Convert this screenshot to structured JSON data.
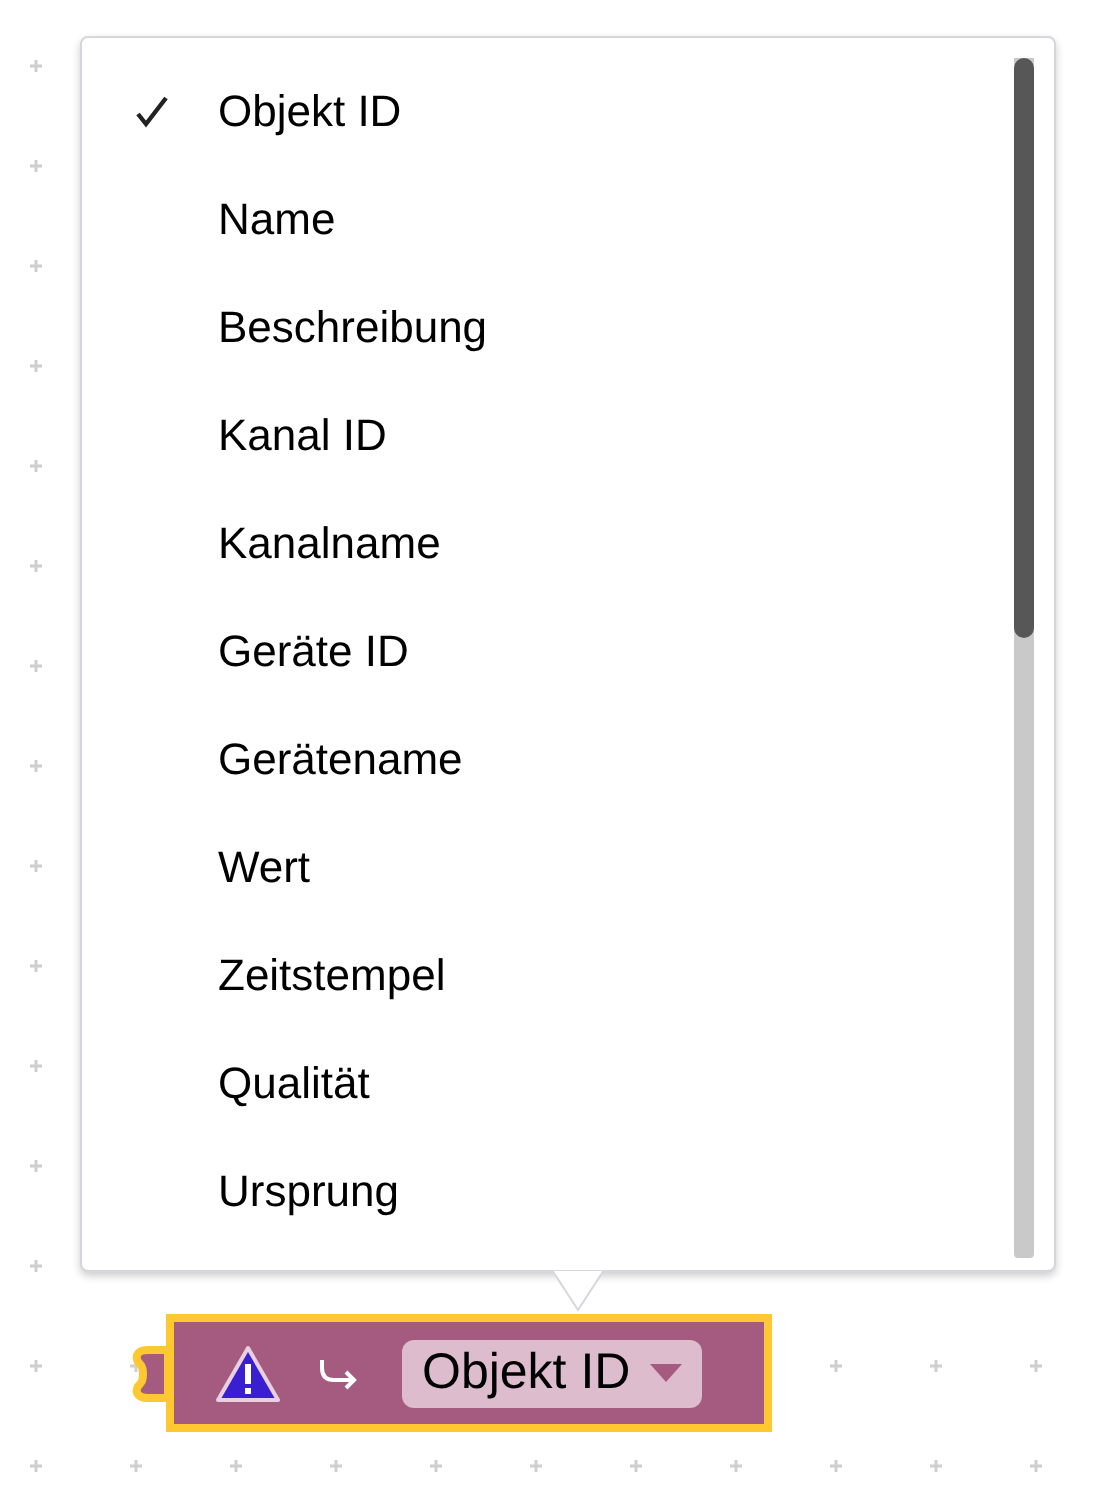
{
  "dropdown_menu": {
    "items": [
      {
        "label": "Objekt ID",
        "selected": true
      },
      {
        "label": "Name",
        "selected": false
      },
      {
        "label": "Beschreibung",
        "selected": false
      },
      {
        "label": "Kanal ID",
        "selected": false
      },
      {
        "label": "Kanalname",
        "selected": false
      },
      {
        "label": "Geräte ID",
        "selected": false
      },
      {
        "label": "Gerätename",
        "selected": false
      },
      {
        "label": "Wert",
        "selected": false
      },
      {
        "label": "Zeitstempel",
        "selected": false
      },
      {
        "label": "Qualität",
        "selected": false
      },
      {
        "label": "Ursprung",
        "selected": false
      }
    ]
  },
  "block": {
    "field_value": "Objekt ID",
    "highlighted": true
  }
}
